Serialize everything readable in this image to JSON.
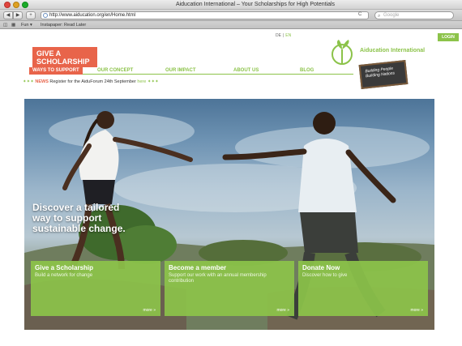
{
  "browser": {
    "window_title": "Aiducation International – Your Scholarships for High Potentials",
    "url": "http://www.aiducation.org/en/Home.html",
    "search_placeholder": "Google",
    "back_glyph": "◀",
    "forward_glyph": "▶",
    "add_glyph": "+",
    "reload_glyph": "C",
    "bookmarks": [
      "Fun ▾",
      "Instapaper: Read Later"
    ]
  },
  "header": {
    "logo_line1": "GIVE A",
    "logo_line2": "SCHOLARSHIP",
    "lang_de": "DE",
    "lang_en": "EN",
    "brand_name": "Aiducation International",
    "login_label": "LOGIN",
    "tagline_line1": "Building People",
    "tagline_line2": "Building Nations"
  },
  "nav": {
    "items": [
      "WAYS TO SUPPORT",
      "OUR CONCEPT",
      "OUR IMPACT",
      "ABOUT US",
      "BLOG"
    ]
  },
  "news": {
    "stars": "✦✦✦",
    "label": "NEWS",
    "text": "Register for the AiduForum 24th September",
    "link": "here",
    "stars_end": "✦✦✦"
  },
  "hero": {
    "headline": "Discover a tailored way to support sustainable change."
  },
  "cards": [
    {
      "title": "Give a Scholarship",
      "desc": "Build a network for change",
      "link": "more »"
    },
    {
      "title": "Become a member",
      "desc": "Support our work with an annual membership contribution",
      "link": "more »"
    },
    {
      "title": "Donate Now",
      "desc": "Discover how to give",
      "link": "more »"
    }
  ],
  "colors": {
    "brand_green": "#8cc34a",
    "brand_coral": "#e8644a"
  }
}
